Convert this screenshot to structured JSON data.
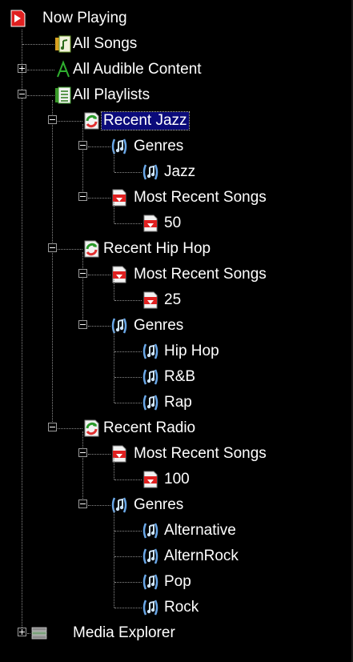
{
  "tree": {
    "now_playing": "Now Playing",
    "all_songs": "All Songs",
    "all_audible_content": "All Audible Content",
    "all_playlists": "All Playlists",
    "recent_jazz": {
      "label": "Recent Jazz",
      "genres": "Genres",
      "genre_items": [
        "Jazz"
      ],
      "most_recent": "Most Recent Songs",
      "count": "50"
    },
    "recent_hip_hop": {
      "label": "Recent Hip Hop",
      "most_recent": "Most Recent Songs",
      "count": "25",
      "genres": "Genres",
      "genre_items": [
        "Hip Hop",
        "R&B",
        "Rap"
      ]
    },
    "recent_radio": {
      "label": "Recent Radio",
      "most_recent": "Most Recent Songs",
      "count": "100",
      "genres": "Genres",
      "genre_items": [
        "Alternative",
        "AlternRock",
        "Pop",
        "Rock"
      ]
    },
    "media_explorer": "Media Explorer"
  },
  "colors": {
    "background": "#000000",
    "text": "#ffffff",
    "selection": "#0a0a7a",
    "tree_lines": "#8a8a8a"
  },
  "icons": {
    "now_playing": "now-playing-icon",
    "all_songs": "music-notes-icon",
    "all_audible": "audible-icon",
    "all_playlists": "playlists-icon",
    "auto_playlist": "auto-playlist-icon",
    "genre": "genre-note-icon",
    "most_recent": "recent-songs-icon",
    "media_explorer": "media-explorer-icon"
  }
}
